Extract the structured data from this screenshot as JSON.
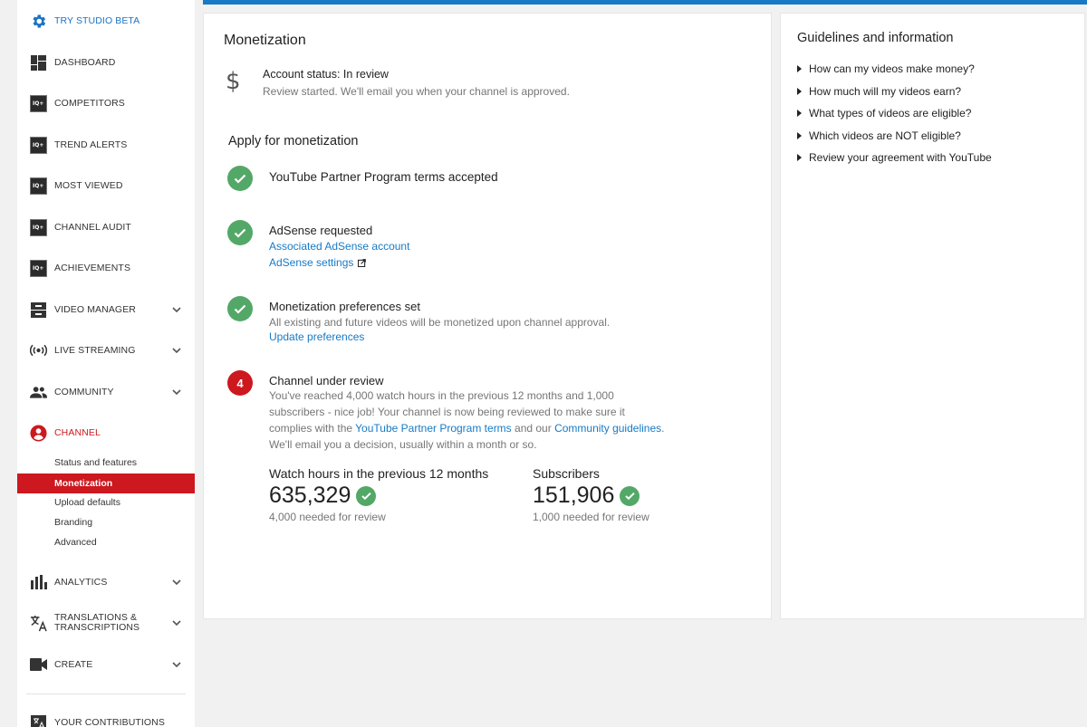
{
  "sidebar": {
    "items": [
      {
        "label": "TRY STUDIO BETA",
        "icon": "gear-icon"
      },
      {
        "label": "DASHBOARD",
        "icon": "dashboard-icon"
      },
      {
        "label": "COMPETITORS",
        "icon": "tubebuddy-icon",
        "icon_text": "IQ+"
      },
      {
        "label": "TREND ALERTS",
        "icon": "tubebuddy-icon",
        "icon_text": "IQ+"
      },
      {
        "label": "MOST VIEWED",
        "icon": "tubebuddy-icon",
        "icon_text": "IQ+"
      },
      {
        "label": "CHANNEL AUDIT",
        "icon": "tubebuddy-icon",
        "icon_text": "IQ+"
      },
      {
        "label": "ACHIEVEMENTS",
        "icon": "tubebuddy-icon",
        "icon_text": "IQ+"
      },
      {
        "label": "VIDEO MANAGER",
        "icon": "video-manager-icon"
      },
      {
        "label": "LIVE STREAMING",
        "icon": "live-streaming-icon"
      },
      {
        "label": "COMMUNITY",
        "icon": "community-icon"
      },
      {
        "label": "CHANNEL",
        "icon": "channel-icon"
      },
      {
        "label": "ANALYTICS",
        "icon": "analytics-icon"
      },
      {
        "label": "TRANSLATIONS &",
        "label2": "TRANSCRIPTIONS",
        "icon": "translate-icon"
      },
      {
        "label": "CREATE",
        "icon": "create-icon"
      },
      {
        "label": "YOUR CONTRIBUTIONS",
        "icon": "translate-icon"
      }
    ],
    "channel_subitems": [
      "Status and features",
      "Monetization",
      "Upload defaults",
      "Branding",
      "Advanced"
    ]
  },
  "main": {
    "title": "Monetization",
    "account_status": {
      "icon": "dollar-icon",
      "icon_glyph": "$",
      "title": "Account status: In review",
      "desc": "Review started. We'll email you when your channel is approved."
    },
    "apply_heading": "Apply for monetization",
    "steps": {
      "s1": {
        "title": "YouTube Partner Program terms accepted"
      },
      "s2": {
        "title": "AdSense requested",
        "link1": "Associated AdSense account",
        "link2": "AdSense settings"
      },
      "s3": {
        "title": "Monetization preferences set",
        "desc": "All existing and future videos will be monetized upon channel approval.",
        "link": "Update preferences"
      },
      "s4": {
        "number": "4",
        "title": "Channel under review",
        "desc_a": "You've reached 4,000 watch hours in the previous 12 months and 1,000 subscribers - nice job! Your channel is now being reviewed to make sure it complies with the ",
        "link_a": "YouTube Partner Program terms",
        "desc_b": " and our ",
        "link_b": "Community guidelines",
        "desc_c": ". We'll email you a decision, usually within a month or so."
      }
    },
    "stats": {
      "watch": {
        "label": "Watch hours in the previous 12 months",
        "value": "635,329",
        "note": "4,000 needed for review"
      },
      "subs": {
        "label": "Subscribers",
        "value": "151,906",
        "note": "1,000 needed for review"
      }
    }
  },
  "guidelines": {
    "title": "Guidelines and information",
    "items": [
      "How can my videos make money?",
      "How much will my videos earn?",
      "What types of videos are eligible?",
      "Which videos are NOT eligible?",
      "Review your agreement with YouTube"
    ]
  },
  "colors": {
    "accent_blue": "#167ac6",
    "red": "#cc181e",
    "green": "#53a868"
  }
}
